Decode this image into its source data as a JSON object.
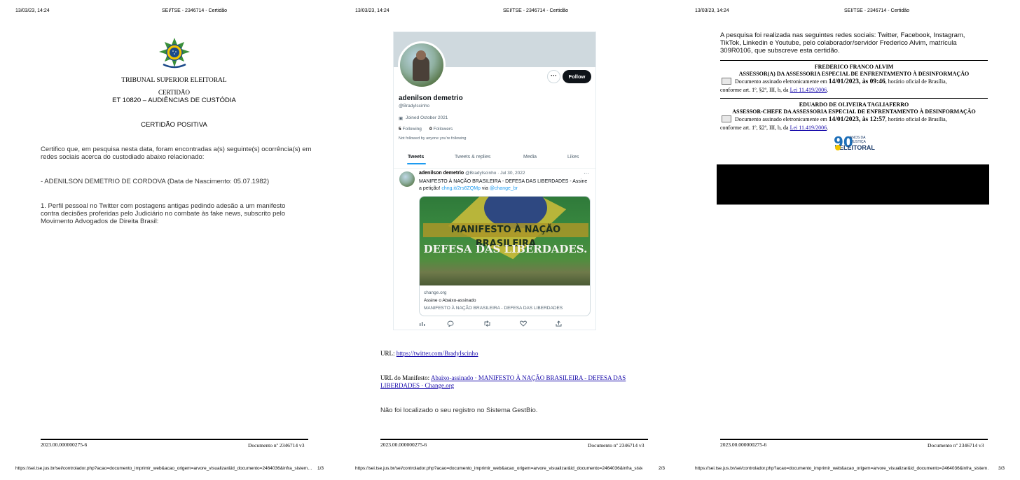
{
  "header": {
    "timestamp": "13/03/23, 14:24",
    "title": "SEI/TSE - 2346714 - Certidão"
  },
  "footer": {
    "process_number": "2023.00.000000275-6",
    "document_label": "Documento nº 2346714 v3",
    "url": "https://sei.tse.jus.br/sei/controlador.php?acao=documento_imprimir_web&acao_origem=arvore_visualizar&id_documento=2464036&infra_sistem…",
    "page_numbers": [
      "1/3",
      "2/3",
      "3/3"
    ]
  },
  "page1": {
    "seal": "brazil-coat-of-arms",
    "court": "TRIBUNAL SUPERIOR ELEITORAL",
    "doc_type": "CERTIDÃO",
    "subject": "ET 10820 – AUDIÊNCIAS DE CUSTÓDIA",
    "heading": "CERTIDÃO POSITIVA",
    "para1": "Certifico que, em pesquisa nesta data, foram encontradas a(s) seguinte(s) ocorrência(s) em redes sociais acerca do custodiado abaixo relacionado:",
    "person": "- ADENILSON DEMETRIO DE CORDOVA (Data de Nascimento: 05.07.1982)",
    "item1": "1. Perfil pessoal no Twitter com postagens antigas pedindo adesão a um manifesto contra decisões proferidas pelo Judiciário no combate às fake news, subscrito pelo Movimento Advogados de Direita Brasil:"
  },
  "page2": {
    "profile": {
      "more_label": "···",
      "follow_label": "Follow",
      "name": "adenilson demetrio",
      "handle": "@BradyIscinho",
      "joined": "Joined October 2021",
      "following_count": "5",
      "following_label": "Following",
      "followers_count": "0",
      "followers_label": "Followers",
      "not_followed": "Not followed by anyone you're following",
      "tabs": [
        "Tweets",
        "Tweets & replies",
        "Media",
        "Likes"
      ]
    },
    "tweet": {
      "author": "adenilson demetrio",
      "meta": "@BradyIscinho · Jul 30, 2022",
      "more": "···",
      "text": "MANIFESTO À NAÇÃO BRASILEIRA - DEFESA DAS LIBERDADES - Assine a petição!",
      "link": "chng.it/2rs6ZQMp",
      "via": "via",
      "mention": "@change_br",
      "image_line1": "MANIFESTO À NAÇÃO BRASILEIRA",
      "image_line2": "DEFESA DAS LIBERDADES.",
      "card_domain": "change.org",
      "card_title": "Assine o Abaixo-assinado",
      "card_desc": "MANIFESTO À NAÇÃO BRASILEIRA - DEFESA DAS LIBERDADES",
      "actions": [
        "analytics-icon",
        "reply-icon",
        "retweet-icon",
        "like-icon",
        "share-icon"
      ]
    },
    "url_label": "URL:",
    "url_value": "https://twitter.com/BradyIscinho",
    "manifest_label": "URL do Manifesto:",
    "manifest_line1": "Abaixo-assinado · MANIFESTO À NAÇÃO BRASILEIRA - DEFESA DAS",
    "manifest_line2": "LIBERDADES · Change.org",
    "gestbio": "Não foi localizado o seu registro no Sistema GestBio."
  },
  "page3": {
    "intro": "A pesquisa foi realizada nas seguintes redes sociais: Twitter, Facebook, Instagram, TikTok, Linkedin e Youtube, pelo colaborador/servidor Frederico Alvim, matrícula 309R0106, que subscreve esta certidão.",
    "signers": [
      {
        "name": "FREDERICO FRANCO ALVIM",
        "role": "ASSESSOR(A) DA ASSESSORIA ESPECIAL DE ENFRENTAMENTO À DESINFORMAÇÃO",
        "sig_prefix": "Documento assinado eletronicamente em",
        "sig_date": "14/01/2023, às 09:46",
        "sig_mid": ", horário oficial de Brasília,",
        "sig_line2": "conforme art. 1º, §2º, III, b, da",
        "law": "Lei 11.419/2006"
      },
      {
        "name": "EDUARDO DE OLIVEIRA TAGLIAFERRO",
        "role": "ASSESSOR-CHEFE DA ASSESSORIA ESPECIAL DE ENFRENTAMENTO À DESINFORMAÇÃO",
        "sig_prefix": "Documento assinado eletronicamente em",
        "sig_date": "14/01/2023, às 12:57",
        "sig_mid": ", horário oficial de Brasília,",
        "sig_line2": "conforme art. 1º, §2º, III, b, da",
        "law": "Lei 11.419/2006"
      }
    ],
    "logo": {
      "number": "90",
      "line1": "ANOS DA",
      "line2": "JUSTIÇA",
      "line3": "ELEITORAL"
    }
  }
}
